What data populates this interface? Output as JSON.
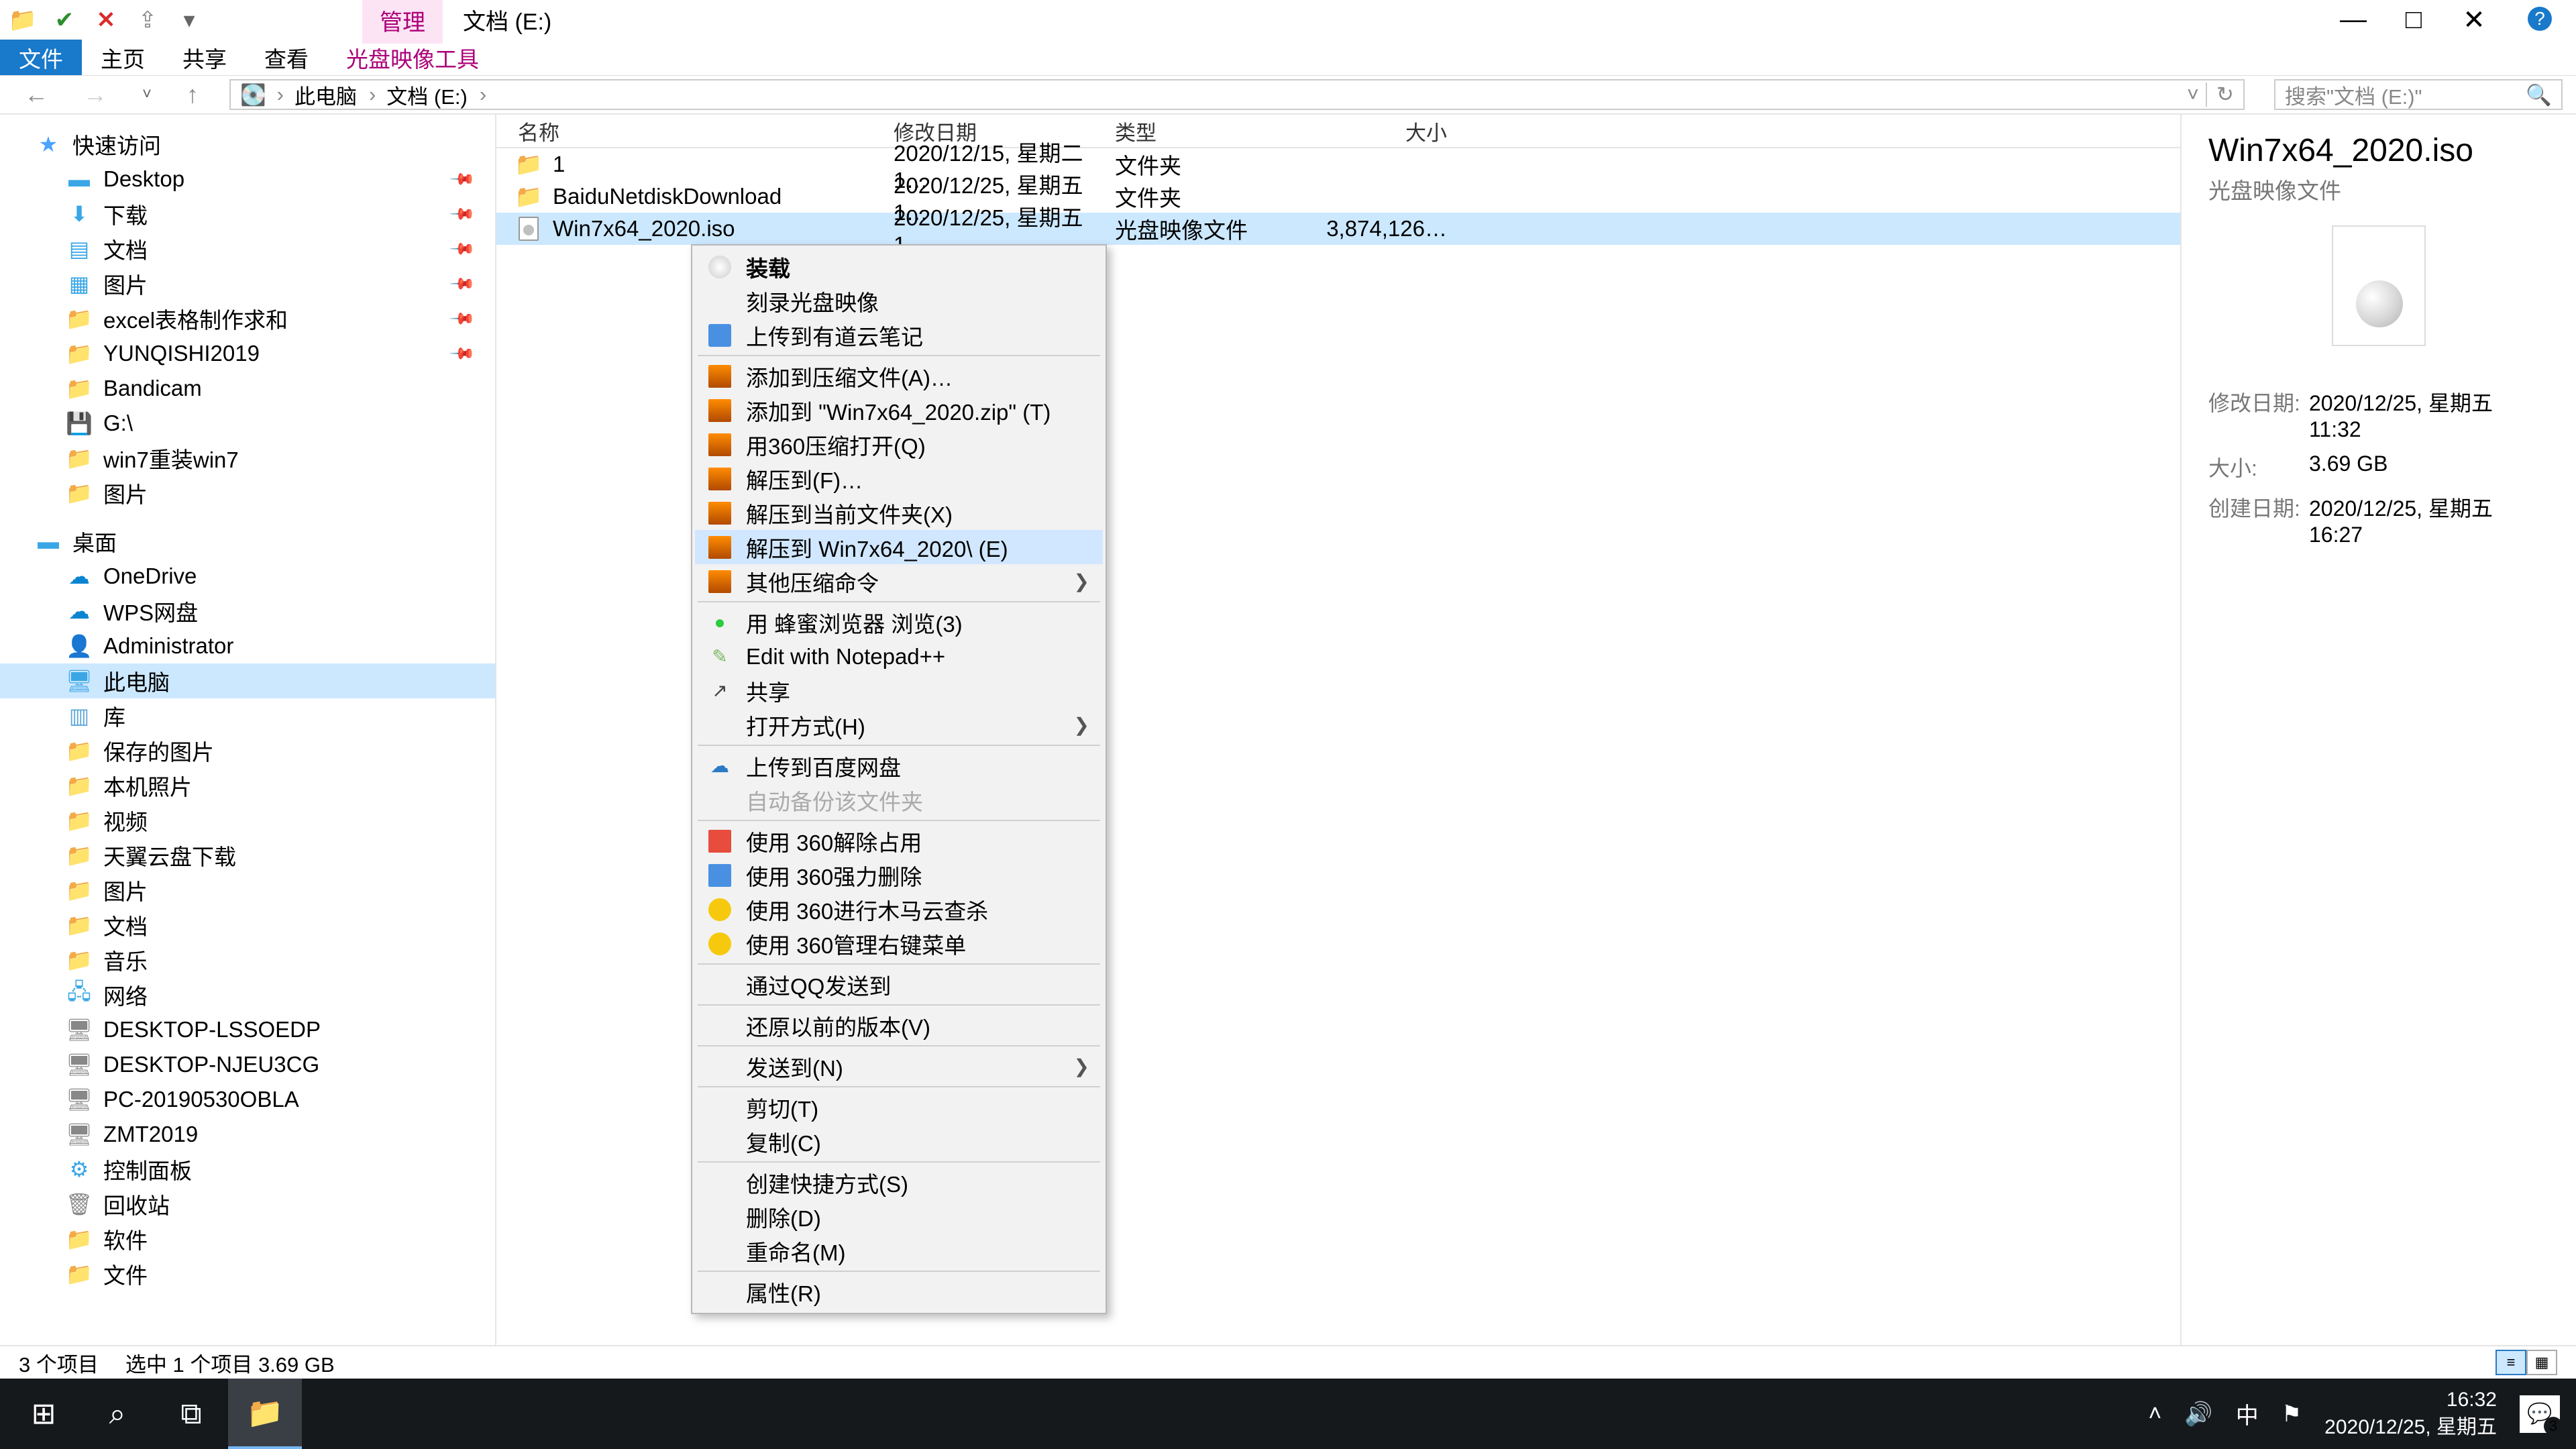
{
  "window": {
    "qat_items": [
      "folder",
      "check",
      "close",
      "share",
      "dropdown"
    ],
    "title_tab_highlight": "管理",
    "title": "文档 (E:)",
    "minimize": "—",
    "maximize": "□",
    "close": "✕",
    "help": "?"
  },
  "ribbon": {
    "tabs": [
      "文件",
      "主页",
      "共享",
      "查看",
      "光盘映像工具"
    ]
  },
  "addressbar": {
    "back": "←",
    "forward": "→",
    "up": "↑",
    "segments": [
      "此电脑",
      "文档 (E:)"
    ],
    "refresh": "↻",
    "dropdown": "˅",
    "search_placeholder": "搜索\"文档 (E:)\""
  },
  "columns": {
    "name": "名称",
    "date": "修改日期",
    "type": "类型",
    "size": "大小"
  },
  "files": [
    {
      "name": "1",
      "date": "2020/12/15, 星期二 1…",
      "type": "文件夹",
      "size": "",
      "icon": "folder"
    },
    {
      "name": "BaiduNetdiskDownload",
      "date": "2020/12/25, 星期五 1…",
      "type": "文件夹",
      "size": "",
      "icon": "folder"
    },
    {
      "name": "Win7x64_2020.iso",
      "date": "2020/12/25, 星期五 1…",
      "type": "光盘映像文件",
      "size": "3,874,126…",
      "icon": "iso",
      "selected": true
    }
  ],
  "navtree": {
    "quick_access": "快速访问",
    "qa_items": [
      "Desktop",
      "下载",
      "文档",
      "图片",
      "excel表格制作求和",
      "YUNQISHI2019",
      "Bandicam",
      "G:\\",
      "win7重装win7",
      "图片"
    ],
    "desktop": "桌面",
    "desktop_items": [
      "OneDrive",
      "WPS网盘",
      "Administrator",
      "此电脑",
      "库"
    ],
    "library_items": [
      "保存的图片",
      "本机照片",
      "视频",
      "天翼云盘下载",
      "图片",
      "文档",
      "音乐"
    ],
    "network": "网络",
    "network_items": [
      "DESKTOP-LSSOEDP",
      "DESKTOP-NJEU3CG",
      "PC-20190530OBLA",
      "ZMT2019"
    ],
    "control_panel": "控制面板",
    "recycle": "回收站",
    "software": "软件",
    "files_folder": "文件"
  },
  "context_menu": [
    {
      "label": "装载",
      "bold": true,
      "icon": "disc"
    },
    {
      "label": "刻录光盘映像"
    },
    {
      "label": "上传到有道云笔记",
      "icon": "note"
    },
    {
      "sep": true
    },
    {
      "label": "添加到压缩文件(A)…",
      "icon": "winrar"
    },
    {
      "label": "添加到 \"Win7x64_2020.zip\" (T)",
      "icon": "winrar"
    },
    {
      "label": "用360压缩打开(Q)",
      "icon": "winrar"
    },
    {
      "label": "解压到(F)…",
      "icon": "winrar"
    },
    {
      "label": "解压到当前文件夹(X)",
      "icon": "winrar"
    },
    {
      "label": "解压到 Win7x64_2020\\ (E)",
      "icon": "winrar",
      "hover": true
    },
    {
      "label": "其他压缩命令",
      "icon": "winrar",
      "submenu": true
    },
    {
      "sep": true
    },
    {
      "label": "用 蜂蜜浏览器 浏览(3)",
      "icon": "green-dot"
    },
    {
      "label": "Edit with Notepad++",
      "icon": "npp"
    },
    {
      "label": "共享",
      "icon": "share"
    },
    {
      "label": "打开方式(H)",
      "submenu": true
    },
    {
      "sep": true
    },
    {
      "label": "上传到百度网盘",
      "icon": "baidu"
    },
    {
      "label": "自动备份该文件夹",
      "disabled": true
    },
    {
      "sep": true
    },
    {
      "label": "使用 360解除占用",
      "icon": "360-red"
    },
    {
      "label": "使用 360强力删除",
      "icon": "360-blue"
    },
    {
      "label": "使用 360进行木马云查杀",
      "icon": "360-yellow"
    },
    {
      "label": "使用 360管理右键菜单",
      "icon": "360-yellow"
    },
    {
      "sep": true
    },
    {
      "label": "通过QQ发送到"
    },
    {
      "sep": true
    },
    {
      "label": "还原以前的版本(V)"
    },
    {
      "sep": true
    },
    {
      "label": "发送到(N)",
      "submenu": true
    },
    {
      "sep": true
    },
    {
      "label": "剪切(T)"
    },
    {
      "label": "复制(C)"
    },
    {
      "sep": true
    },
    {
      "label": "创建快捷方式(S)"
    },
    {
      "label": "删除(D)"
    },
    {
      "label": "重命名(M)"
    },
    {
      "sep": true
    },
    {
      "label": "属性(R)"
    }
  ],
  "details": {
    "filename": "Win7x64_2020.iso",
    "filetype": "光盘映像文件",
    "rows": [
      {
        "label": "修改日期:",
        "value": "2020/12/25, 星期五 11:32"
      },
      {
        "label": "大小:",
        "value": "3.69 GB"
      },
      {
        "label": "创建日期:",
        "value": "2020/12/25, 星期五 16:27"
      }
    ]
  },
  "statusbar": {
    "count": "3 个项目",
    "selection": "选中 1 个项目  3.69 GB"
  },
  "taskbar": {
    "time": "16:32",
    "date": "2020/12/25, 星期五",
    "ime": "中",
    "notif_count": "3"
  }
}
